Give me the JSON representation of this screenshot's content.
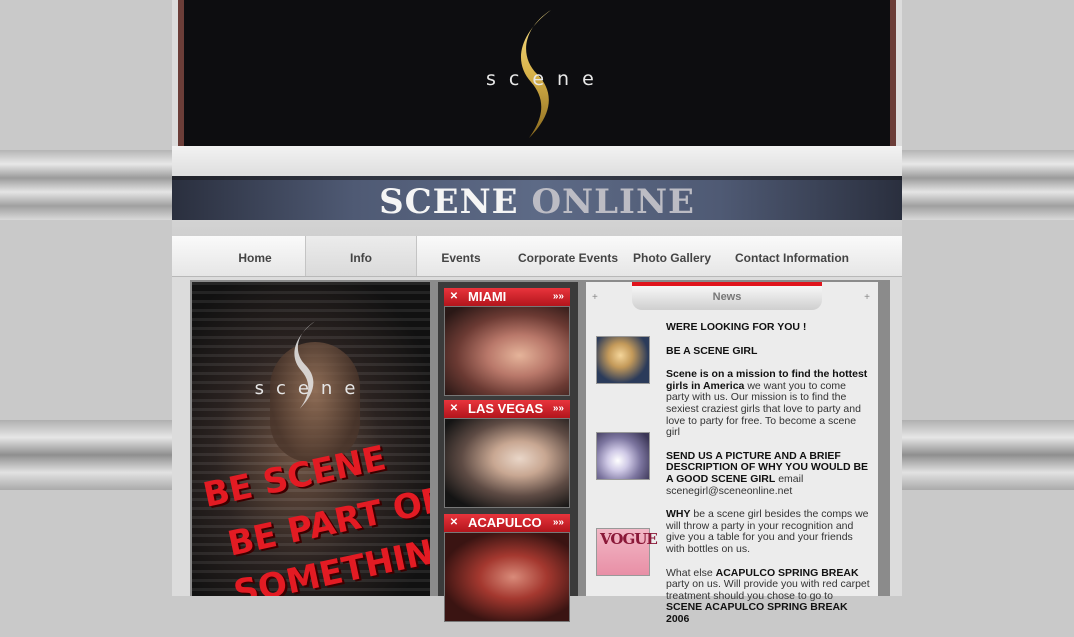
{
  "logo": {
    "text": "scene"
  },
  "banner": {
    "word1": "SCENE",
    "word2": "ONLINE"
  },
  "nav": {
    "items": [
      {
        "label": "Home"
      },
      {
        "label": "Info"
      },
      {
        "label": "Events"
      },
      {
        "label": "Corporate Events"
      },
      {
        "label": "Photo Gallery"
      },
      {
        "label": "Contact Information"
      }
    ],
    "active": "Info"
  },
  "promo": {
    "logo_text": "scene",
    "slogan_lines": [
      "BE SCENE",
      "BE PART OF",
      "SOMETHING"
    ]
  },
  "cities": [
    {
      "name": "MIAMI"
    },
    {
      "name": "LAS VEGAS"
    },
    {
      "name": "ACAPULCO"
    }
  ],
  "news": {
    "header": "News",
    "heading1": "WERE LOOKING FOR YOU !",
    "heading2": "BE A SCENE GIRL",
    "p1_bold": "Scene is on a mission to find the hottest girls in America",
    "p1_rest": " we want you to come party with us. Our mission is to find the sexiest craziest girls that love to party and love to party for free. To become a scene girl",
    "p2_bold": "SEND US A PICTURE AND A BRIEF DESCRIPTION OF WHY YOU WOULD BE A GOOD SCENE GIRL",
    "p2_rest": " email",
    "email": "scenegirl@sceneonline.net",
    "p3_bold": "WHY",
    "p3_rest": " be a scene girl besides the comps we will throw a party in your recognition and give you a table for you and your friends with bottles on us.",
    "p4_start": "What else ",
    "p4_bold1": "ACAPULCO SPRING BREAK",
    "p4_mid": " party on us. Will provide you with red carpet treatment should you chose to go to ",
    "p4_bold2": "SCENE ACAPULCO SPRING BREAK 2006",
    "thumb3_text": "VOGUE"
  },
  "colors": {
    "accent_red": "#e31b23",
    "header_bg": "#0d0d10",
    "gold": "#d8b24a"
  }
}
